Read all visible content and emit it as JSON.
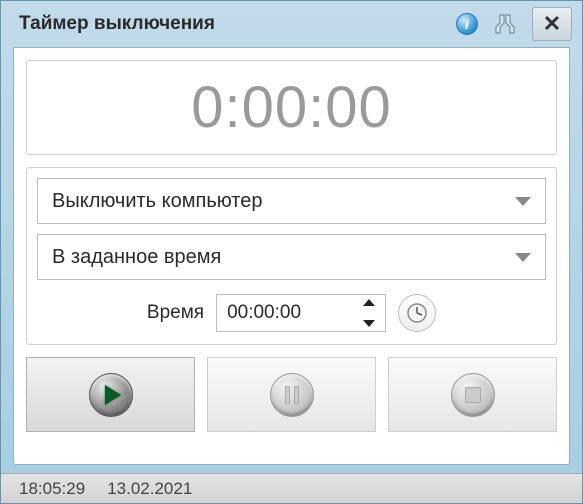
{
  "window": {
    "title": "Таймер выключения"
  },
  "timer_display": "0:00:00",
  "action_select": "Выключить компьютер",
  "mode_select": "В заданное время",
  "time_label": "Время",
  "time_value": "00:00:00",
  "status": {
    "time": "18:05:29",
    "date": "13.02.2021"
  }
}
